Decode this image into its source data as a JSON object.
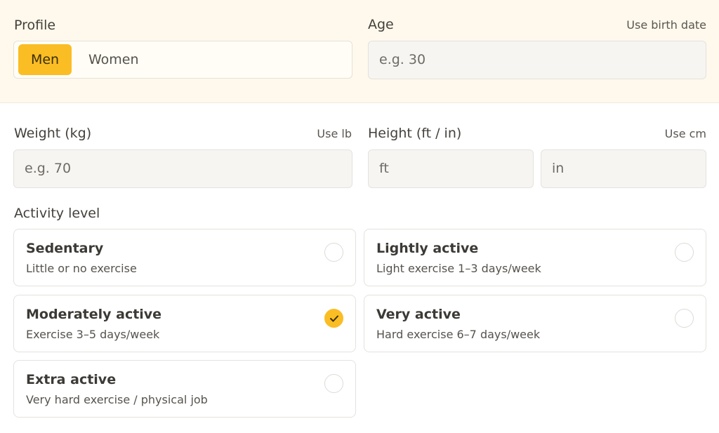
{
  "profile": {
    "label": "Profile",
    "options": [
      "Men",
      "Women"
    ],
    "selected": "Men"
  },
  "age": {
    "label": "Age",
    "toggle_label": "Use birth date",
    "placeholder": "e.g. 30"
  },
  "weight": {
    "label": "Weight (kg)",
    "toggle_label": "Use lb",
    "placeholder": "e.g. 70"
  },
  "height": {
    "label": "Height (ft / in)",
    "toggle_label": "Use cm",
    "ft_placeholder": "ft",
    "in_placeholder": "in"
  },
  "activity": {
    "label": "Activity level",
    "options": [
      {
        "title": "Sedentary",
        "desc": "Little or no exercise",
        "selected": false
      },
      {
        "title": "Lightly active",
        "desc": "Light exercise 1–3 days/week",
        "selected": false
      },
      {
        "title": "Moderately active",
        "desc": "Exercise 3–5 days/week",
        "selected": true
      },
      {
        "title": "Very active",
        "desc": "Hard exercise 6–7 days/week",
        "selected": false
      },
      {
        "title": "Extra active",
        "desc": "Very hard exercise / physical job",
        "selected": false
      }
    ]
  },
  "colors": {
    "accent": "#fbbd24",
    "top_band": "#fef9ec"
  },
  "icons": {
    "checked_radio": "check-icon"
  }
}
